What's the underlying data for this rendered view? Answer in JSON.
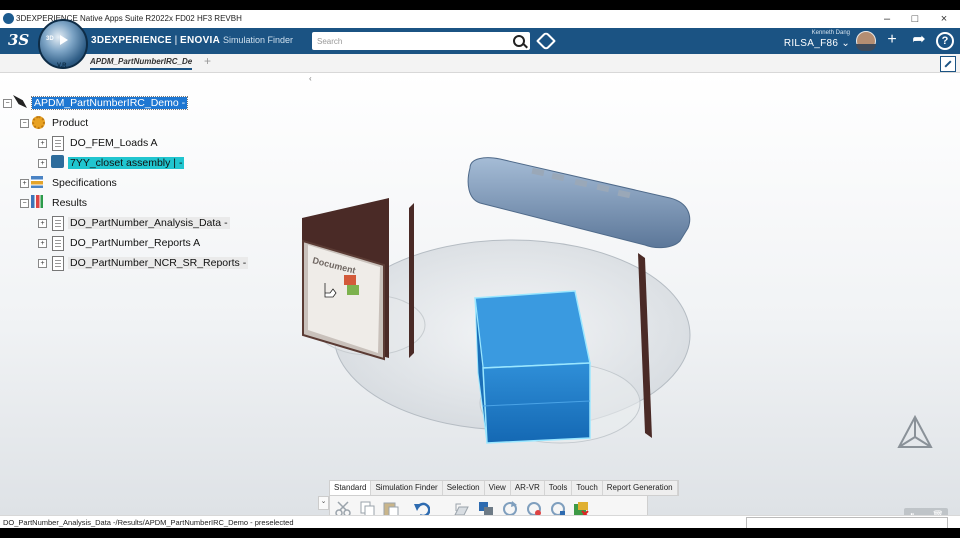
{
  "window": {
    "title": "3DEXPERIENCE Native Apps Suite R2022x FD02 HF3 REVBH",
    "controls": {
      "minimize": "–",
      "maximize": "□",
      "close": "×"
    }
  },
  "topbar": {
    "brand_bold": "3DEXPERIENCE",
    "brand_sep": " | ",
    "brand_app": "ENOVIA",
    "brand_sub": "Simulation Finder",
    "search_placeholder": "Search",
    "user_name": "Kenneth Dang",
    "role": "RILSA_F86",
    "role_caret": "⌄",
    "compass_version": "V.R",
    "compass_3d": "3D",
    "icons": [
      "search-icon",
      "tag-icon",
      "add-icon",
      "share-icon",
      "help-icon"
    ],
    "add_glyph": "+",
    "share_glyph": "➦",
    "help_glyph": "?",
    "accent_color": "#1b5383"
  },
  "tab": {
    "label": "APDM_PartNumberIRC_De",
    "add_glyph": "+"
  },
  "tree": {
    "collapse_glyph": "‹",
    "root": "APDM_PartNumberIRC_Demo -",
    "product": "Product",
    "product_children": [
      "DO_FEM_Loads A",
      "7YY_closet assembly | -"
    ],
    "specifications": "Specifications",
    "results": "Results",
    "results_children": [
      "DO_PartNumber_Analysis_Data -",
      "DO_PartNumber_Reports A",
      "DO_PartNumber_NCR_SR_Reports -"
    ],
    "selection_color": "#1e77d2",
    "highlight_color": "#20c5cf"
  },
  "scene": {
    "doc_text": "Document"
  },
  "toolbar": {
    "tabs": [
      "Standard",
      "Simulation Finder",
      "Selection",
      "View",
      "AR-VR",
      "Tools",
      "Touch",
      "Report Generation"
    ],
    "active_tab": "Standard",
    "icons": [
      "cut-icon",
      "copy-icon",
      "paste-icon",
      "undo-icon",
      "open-icon",
      "reframe-icon",
      "refresh-icon",
      "update-icon",
      "synchronize-icon",
      "check-icon"
    ],
    "dropdown_glyph": "⌄"
  },
  "pause": {
    "pause_glyph": "⏸",
    "trash_glyph": "🗑"
  },
  "status": {
    "text": "DO_PartNumber_Analysis_Data -/Results/APDM_PartNumberIRC_Demo - preselected"
  }
}
